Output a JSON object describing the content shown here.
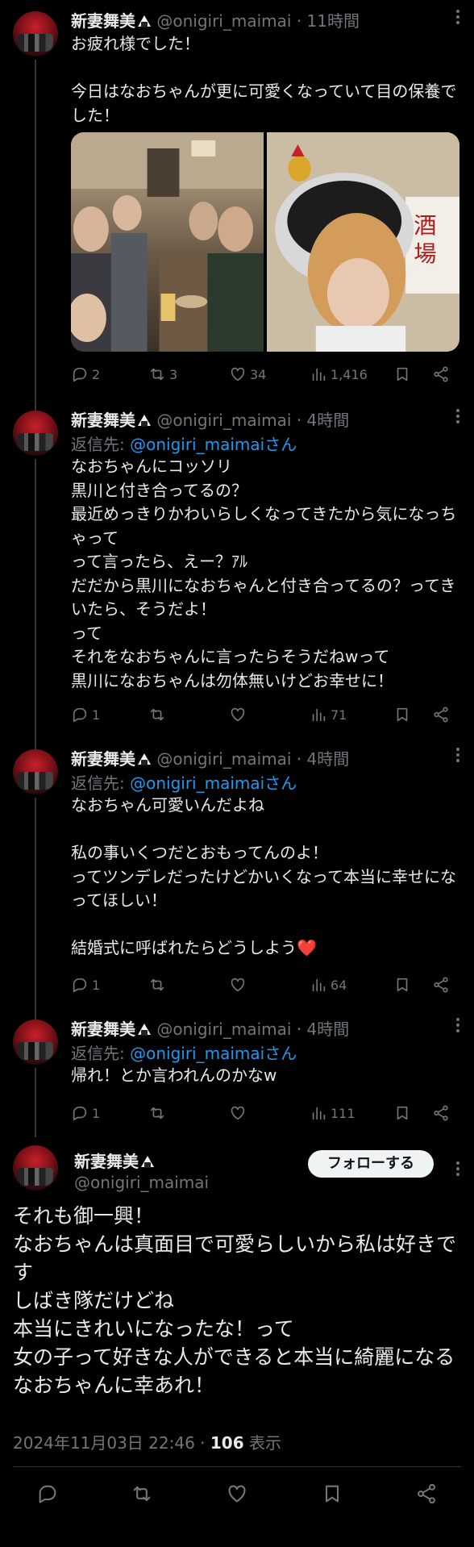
{
  "tweets": [
    {
      "name": "新妻舞美",
      "handle": "@onigiri_maimai",
      "sep": "·",
      "time": "11時間",
      "text": "お疲れ様でした！\n\n今日はなおちゃんが更に可愛くなっていて目の保養でした！",
      "replies": "2",
      "retweets": "3",
      "likes": "34",
      "views": "1,416"
    },
    {
      "name": "新妻舞美",
      "handle": "@onigiri_maimai",
      "sep": "·",
      "time": "4時間",
      "reply_label": "返信先: ",
      "reply_to": "@onigiri_maimaiさん",
      "text": "なおちゃんにコッソリ\n黒川と付き合ってるの？\n最近めっきりかわいらしくなってきたから気になっちゃって\nって言ったら、えー？ｱﾙ\nだだから黒川になおちゃんと付き合ってるの？ってきいたら、そうだよ！\nって\nそれをなおちゃんに言ったらそうだねwって\n黒川になおちゃんは勿体無いけどお幸せに！",
      "replies": "1",
      "retweets": "",
      "likes": "",
      "views": "71"
    },
    {
      "name": "新妻舞美",
      "handle": "@onigiri_maimai",
      "sep": "·",
      "time": "4時間",
      "reply_label": "返信先: ",
      "reply_to": "@onigiri_maimaiさん",
      "text": "なおちゃん可愛いんだよね\n\n私の事いくつだとおもってんのよ！\nってツンデレだったけどかいくなって本当に幸せになってほしい！\n\n結婚式に呼ばれたらどうしよう❤️",
      "replies": "1",
      "retweets": "",
      "likes": "",
      "views": "64"
    },
    {
      "name": "新妻舞美",
      "handle": "@onigiri_maimai",
      "sep": "·",
      "time": "4時間",
      "reply_label": "返信先: ",
      "reply_to": "@onigiri_maimaiさん",
      "text": "帰れ！とか言われんのかなw",
      "replies": "1",
      "retweets": "",
      "likes": "",
      "views": "111"
    }
  ],
  "main": {
    "name": "新妻舞美",
    "handle": "@onigiri_maimai",
    "follow_label": "フォローする",
    "text": "それも御一興！\nなおちゃんは真面目で可愛らしいから私は好きです\nしばき隊だけどね\n本当にきれいになったな！って\n女の子って好きな人ができると本当に綺麗になる\nなおちゃんに幸あれ！",
    "timestamp": "2024年11月03日 22:46 · ",
    "views_count": "106",
    "views_label": " 表示"
  },
  "colors": {
    "link": "#1d9bf0",
    "muted": "#71767b",
    "background": "#000000"
  }
}
